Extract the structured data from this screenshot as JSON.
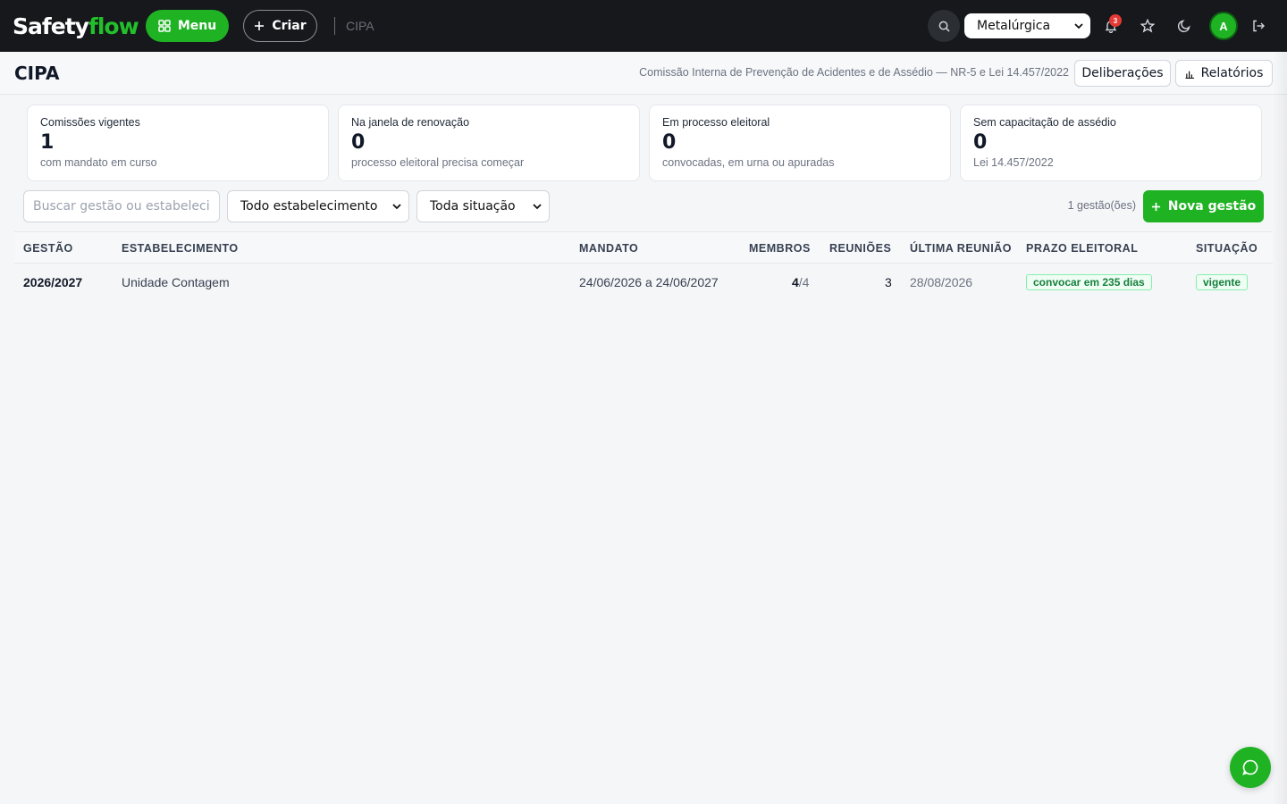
{
  "topbar": {
    "logo_part1": "Safety",
    "logo_part2": "flow",
    "menu_label": "Menu",
    "criar_label": "Criar",
    "breadcrumb": "CIPA",
    "tenant": "Metalúrgica",
    "notifications_count": "3",
    "avatar_initial": "A"
  },
  "header": {
    "title": "CIPA",
    "subtitle": "Comissão Interna de Prevenção de Acidentes e de Assédio — NR-5 e Lei 14.457/2022",
    "deliberacoes_label": "Deliberações",
    "relatorios_label": "Relatórios"
  },
  "cards": [
    {
      "label": "Comissões vigentes",
      "value": "1",
      "note": "com mandato em curso"
    },
    {
      "label": "Na janela de renovação",
      "value": "0",
      "note": "processo eleitoral precisa começar"
    },
    {
      "label": "Em processo eleitoral",
      "value": "0",
      "note": "convocadas, em urna ou apuradas"
    },
    {
      "label": "Sem capacitação de assédio",
      "value": "0",
      "note": "Lei 14.457/2022"
    }
  ],
  "filters": {
    "search_placeholder": "Buscar gestão ou estabeleci",
    "estabelecimento": "Todo estabelecimento",
    "situacao": "Toda situação",
    "count_text": "1 gestão(ões)",
    "nova_label": "Nova gestão"
  },
  "table": {
    "headers": {
      "gestao": "GESTÃO",
      "estabelecimento": "ESTABELECIMENTO",
      "mandato": "MANDATO",
      "membros": "MEMBROS",
      "reunioes": "REUNIÕES",
      "ultima": "ÚLTIMA REUNIÃO",
      "prazo": "PRAZO ELEITORAL",
      "situacao": "SITUAÇÃO"
    },
    "rows": [
      {
        "gestao": "2026/2027",
        "estabelecimento": "Unidade Contagem",
        "mandato": "24/06/2026 a 24/06/2027",
        "membros_num": "4",
        "membros_den": "/4",
        "reunioes": "3",
        "ultima": "28/08/2026",
        "prazo": "convocar em 235 dias",
        "situacao": "vigente"
      }
    ]
  },
  "colors": {
    "brand_green": "#1fb324",
    "topbar_bg": "#16181c",
    "badge_red": "#e53935"
  }
}
